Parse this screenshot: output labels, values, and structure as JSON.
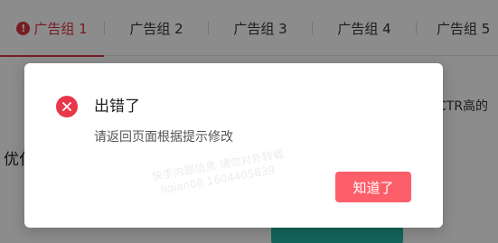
{
  "tabs": [
    {
      "label": "广告组 1",
      "active": true,
      "has_error": true
    },
    {
      "label": "广告组 2",
      "active": false
    },
    {
      "label": "广告组 3",
      "active": false
    },
    {
      "label": "广告组 4",
      "active": false
    },
    {
      "label": "广告组 5",
      "active": false
    }
  ],
  "background": {
    "right_hint": "CTR高的",
    "left_label": "优化"
  },
  "dialog": {
    "icon": "close-circle-icon",
    "title": "出错了",
    "message": "请返回页面根据提示修改",
    "confirm_label": "知道了"
  },
  "watermark": {
    "line1": "快手内部信息 请勿对外转载",
    "line2": "liqian08 1604405839"
  },
  "colors": {
    "accent": "#d9363e",
    "error_icon": "#e8374a",
    "confirm_button": "#fc5f6a",
    "teal_button": "#23b8a6"
  }
}
